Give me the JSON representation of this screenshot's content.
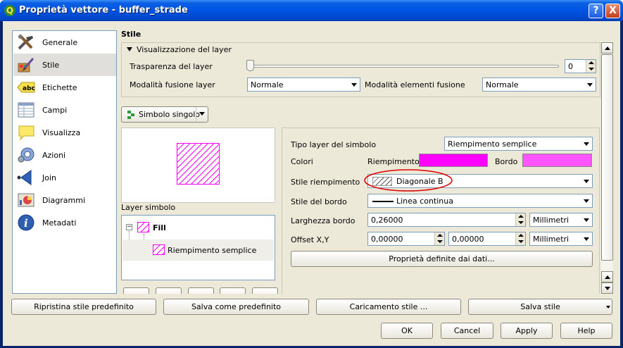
{
  "window": {
    "title": "Proprietà vettore - buffer_strade",
    "help_button": "?",
    "close_button": "X",
    "app_icon_letter": "Q"
  },
  "sidebar": {
    "items": [
      {
        "label": "Generale",
        "icon": "tools-icon"
      },
      {
        "label": "Stile",
        "icon": "paintbrush-icon"
      },
      {
        "label": "Etichette",
        "icon": "abc-label-icon"
      },
      {
        "label": "Campi",
        "icon": "table-fields-icon"
      },
      {
        "label": "Visualizza",
        "icon": "speech-bubble-icon"
      },
      {
        "label": "Azioni",
        "icon": "gear-action-icon"
      },
      {
        "label": "Join",
        "icon": "join-arrow-icon"
      },
      {
        "label": "Diagrammi",
        "icon": "diagram-icon"
      },
      {
        "label": "Metadati",
        "icon": "info-icon"
      }
    ],
    "selected_index": 1
  },
  "style": {
    "section_title": "Stile",
    "rendering_group": {
      "title": "Visualizzazione del layer",
      "transparency_label": "Trasparenza del layer",
      "transparency_value": "0",
      "transparency_level": 0,
      "blend_layer_label": "Modalità fusione layer",
      "blend_layer_value": "Normale",
      "blend_features_label": "Modalità elementi fusione",
      "blend_features_value": "Normale"
    },
    "renderer_button": "Simbolo singolo",
    "symbol_layers_label": "Layer simbolo",
    "symbol_tree": {
      "root": "Fill",
      "child": "Riempimento semplice"
    },
    "properties": {
      "symbol_layer_type_label": "Tipo layer del simbolo",
      "symbol_layer_type_value": "Riempimento semplice",
      "colors_label": "Colori",
      "fill_label": "Riempimento",
      "fill_color": "#ff00ff",
      "border_label": "Bordo",
      "border_color": "#ff55ff",
      "fill_style_label": "Stile riempimento",
      "fill_style_value": "Diagonale B",
      "border_style_label": "Stile del bordo",
      "border_style_value": "Linea continua",
      "border_width_label": "Larghezza bordo",
      "border_width_value": "0,26000",
      "border_width_unit": "Millimetri",
      "offset_label": "Offset X,Y",
      "offset_x": "0,00000",
      "offset_y": "0,00000",
      "offset_unit": "Millimetri",
      "data_defined_button": "Proprietà definite dai dati..."
    }
  },
  "bottom_buttons": {
    "restore_default": "Ripristina stile predefinito",
    "save_default": "Salva come predefinito",
    "load_style": "Caricamento stile ...",
    "save_style": "Salva stile"
  },
  "dialog_buttons": {
    "ok": "OK",
    "cancel": "Cancel",
    "apply": "Apply",
    "help": "Help"
  },
  "colors": {
    "titlebar": "#0054e3",
    "dialog_bg": "#ece9d8",
    "highlight_ellipse": "#e00000"
  }
}
